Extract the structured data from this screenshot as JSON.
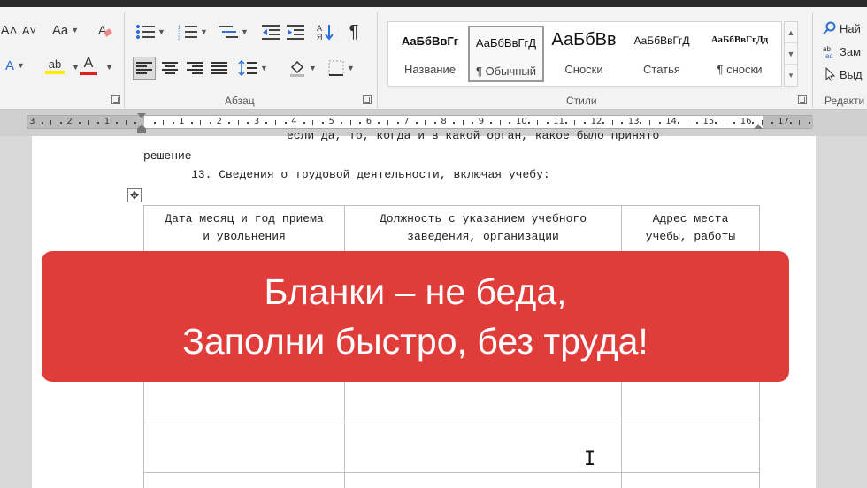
{
  "ribbon": {
    "font_group": {
      "grow_font": "A˄",
      "shrink_font": "A˅",
      "change_case": "Aa",
      "text_effects": "A",
      "highlight": "ab",
      "font_color": "A"
    },
    "paragraph_group_label": "Абзац",
    "styles_group_label": "Стили",
    "editing_group_label": "Редакти",
    "styles": [
      {
        "sample": "АаБбВвГг",
        "name": "Название"
      },
      {
        "sample": "АаБбВвГгД",
        "name": "¶ Обычный"
      },
      {
        "sample": "АаБбВв",
        "name": "Сноски"
      },
      {
        "sample": "АаБбВвГгД",
        "name": "Статья"
      },
      {
        "sample": "АаБбВвГгДд",
        "name": "¶ сноски"
      }
    ],
    "editing": {
      "find": "Най",
      "replace": "Зам",
      "select": "Выд"
    }
  },
  "ruler": {
    "numbers": [
      "3",
      "2",
      "1",
      "1",
      "2",
      "3",
      "4",
      "5",
      "6",
      "7",
      "8",
      "9",
      "10",
      "11",
      "12",
      "13",
      "14",
      "15",
      "16",
      "17"
    ]
  },
  "document": {
    "line_cut": "если да, то, когда и в какой орган, какое было принято",
    "line_solution": "решение",
    "line_13": "13. Сведения о трудовой деятельности, включая учебу:",
    "table_headers": [
      {
        "l1": "Дата месяц и год приема",
        "l2": "и увольнения"
      },
      {
        "l1": "Должность с указанием учебного",
        "l2": "заведения, организации"
      },
      {
        "l1": "Адрес места",
        "l2": "учебы, работы"
      }
    ]
  },
  "banner": {
    "line1": "Бланки – не беда,",
    "line2": "Заполни быстро, без труда!"
  },
  "colors": {
    "banner_bg": "#e03d3a",
    "highlight_yellow": "#ffeb00",
    "font_red": "#e02020"
  }
}
